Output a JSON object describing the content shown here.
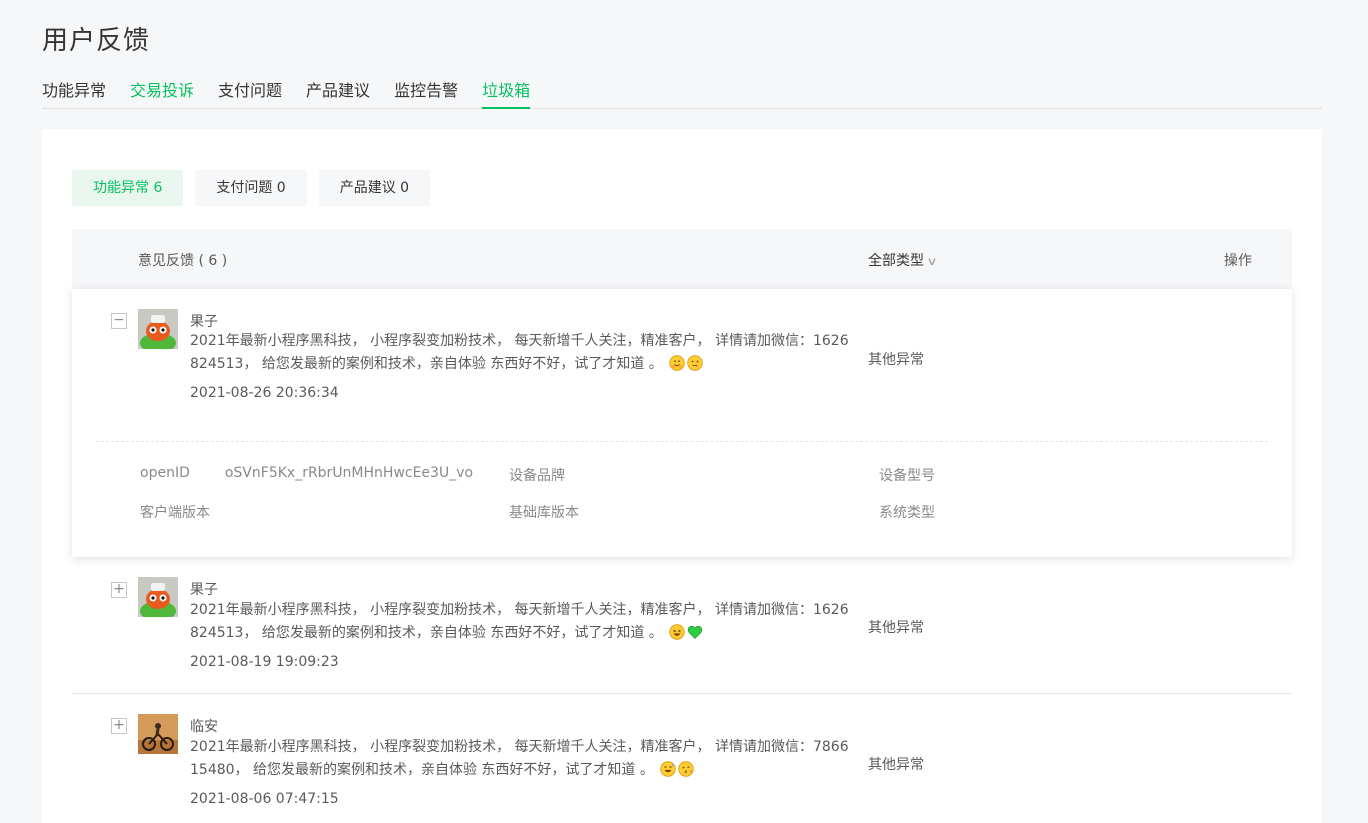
{
  "page": {
    "title": "用户反馈"
  },
  "main_tabs": [
    {
      "label": "功能异常"
    },
    {
      "label": "交易投诉"
    },
    {
      "label": "支付问题"
    },
    {
      "label": "产品建议"
    },
    {
      "label": "监控告警"
    },
    {
      "label": "垃圾箱"
    }
  ],
  "sub_tabs": [
    {
      "label": "功能异常 6"
    },
    {
      "label": "支付问题 0"
    },
    {
      "label": "产品建议 0"
    }
  ],
  "table": {
    "col_feedback": "意见反馈 ( 6 )",
    "col_type": "全部类型",
    "col_op": "操作"
  },
  "rows": [
    {
      "user": "果子",
      "content": "2021年最新小程序黑科技， 小程序裂变加粉技术， 每天新增千人关注，精准客户， 详情请加微信：1626824513， 给您发最新的案例和技术，亲自体验 东西好不好，试了才知道 。",
      "emojis": [
        "hug-emoji",
        "confused-emoji"
      ],
      "time": "2021-08-26 20:36:34",
      "type": "其他异常",
      "toggle": "−",
      "details": {
        "openid_label": "openID",
        "openid_value": "oSVnF5Kx_rRbrUnMHnHwcEe3U_vo",
        "brand_label": "设备品牌",
        "model_label": "设备型号",
        "client_label": "客户端版本",
        "lib_label": "基础库版本",
        "os_label": "系统类型"
      }
    },
    {
      "user": "果子",
      "content": "2021年最新小程序黑科技， 小程序裂变加粉技术， 每天新增千人关注，精准客户， 详情请加微信：1626824513， 给您发最新的案例和技术，亲自体验 东西好不好，试了才知道 。",
      "emojis": [
        "grin-emoji",
        "green-heart-emoji"
      ],
      "time": "2021-08-19 19:09:23",
      "type": "其他异常",
      "toggle": "+"
    },
    {
      "user": "临安",
      "content": "2021年最新小程序黑科技， 小程序裂变加粉技术， 每天新增千人关注，精准客户， 详情请加微信：786615480， 给您发最新的案例和技术，亲自体验 东西好不好，试了才知道 。",
      "emojis": [
        "sweat-smile-emoji",
        "kiss-wink-emoji"
      ],
      "time": "2021-08-06 07:47:15",
      "type": "其他异常",
      "toggle": "+"
    }
  ],
  "colors": {
    "accent": "#07c160",
    "accent_bg": "#e8f6ee",
    "muted_bg": "#f6f7f9"
  }
}
